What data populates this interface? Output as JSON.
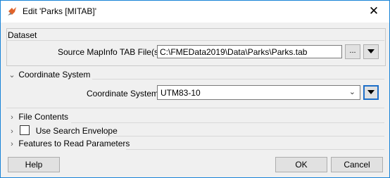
{
  "window": {
    "title": "Edit 'Parks [MITAB]'",
    "close_glyph": "✕"
  },
  "dataset": {
    "header": "Dataset",
    "source_label": "Source MapInfo TAB File(s):",
    "source_value": "C:\\FMEData2019\\Data\\Parks\\Parks.tab",
    "browse_label": "..."
  },
  "coordinate_system": {
    "header": "Coordinate System",
    "label": "Coordinate System:",
    "value": "UTM83-10"
  },
  "sections": {
    "file_contents": "File Contents",
    "use_search_envelope": "Use Search Envelope",
    "features_to_read": "Features to Read Parameters"
  },
  "buttons": {
    "help": "Help",
    "ok": "OK",
    "cancel": "Cancel"
  }
}
